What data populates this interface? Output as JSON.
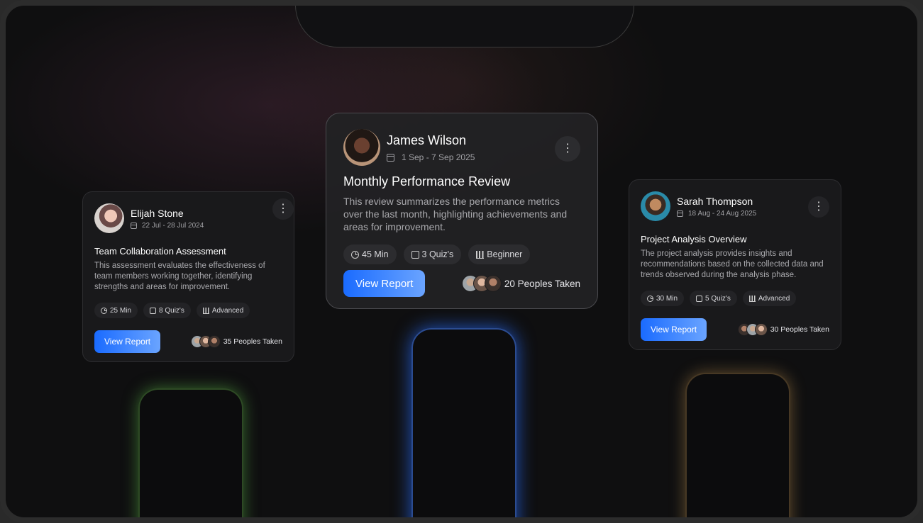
{
  "cards": [
    {
      "name": "Elijah Stone",
      "date": "22 Jul - 28 Jul 2024",
      "title": "Team Collaboration Assessment",
      "description": "This assessment evaluates the effectiveness of team members working together, identifying strengths and areas for improvement.",
      "duration": "25 Min",
      "quizzes": "8 Quiz's",
      "level": "Advanced",
      "button_label": "View Report",
      "takers": "35 Peoples Taken"
    },
    {
      "name": "James Wilson",
      "date": "1 Sep - 7 Sep 2025",
      "title": "Monthly Performance Review",
      "description": "This review summarizes the performance metrics over the last month, highlighting achievements and areas for improvement.",
      "duration": "45 Min",
      "quizzes": "3 Quiz's",
      "level": "Beginner",
      "button_label": "View Report",
      "takers": "20 Peoples Taken"
    },
    {
      "name": "Sarah Thompson",
      "date": "18 Aug - 24 Aug 2025",
      "title": "Project Analysis Overview",
      "description": "The project analysis provides insights and recommendations based on the collected data and trends observed during the analysis phase.",
      "duration": "30 Min",
      "quizzes": "5 Quiz's",
      "level": "Advanced",
      "button_label": "View Report",
      "takers": "30 Peoples Taken"
    }
  ],
  "more_icon": "more-vertical-icon",
  "colors": {
    "accent": "#1a6bff",
    "glow_green": "#5ab446",
    "glow_blue": "#286eff",
    "glow_orange": "#c89650"
  }
}
